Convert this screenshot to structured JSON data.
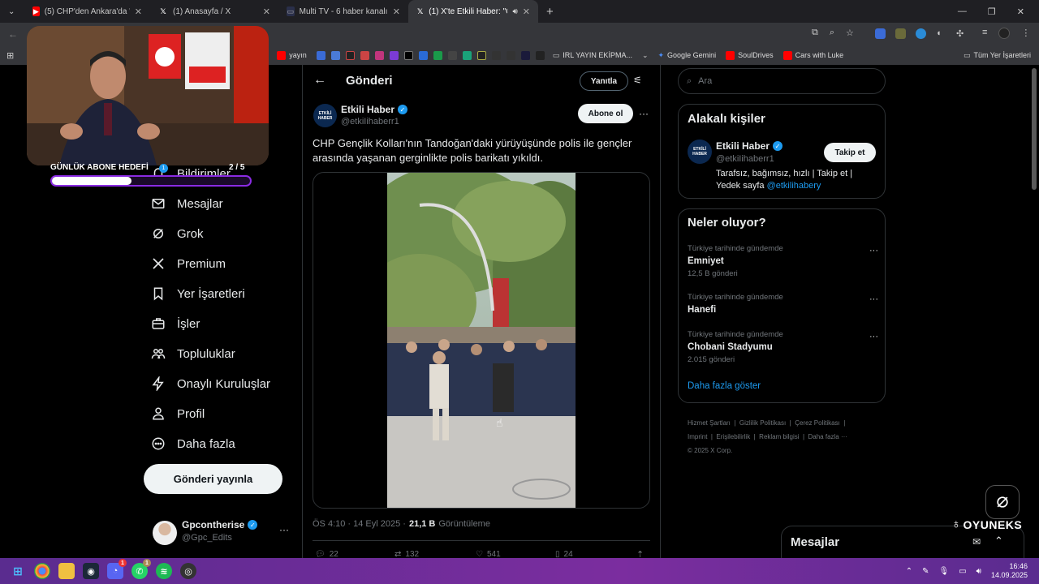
{
  "tabs": [
    {
      "label": "(5) CHP'den Ankara'da \"Vesayet",
      "icon": "youtube-icon",
      "color": "#ff0000"
    },
    {
      "label": "(1) Anasayfa / X",
      "icon": "x-icon",
      "color": "#ffffff"
    },
    {
      "label": "Multi TV - 6 haber kanalını ayn",
      "icon": "tv-icon",
      "color": "#333333"
    },
    {
      "label": "(1) X'te Etkili Haber: \"CHP G",
      "icon": "x-icon",
      "color": "#ffffff"
    }
  ],
  "bookmarks": [
    {
      "label": "yayın",
      "color": "#ff0000"
    },
    {
      "label": "IRL YAYIN EKİPMA...",
      "color": "#888888"
    },
    {
      "label": "Google Gemini",
      "color": "#4a8cf7"
    },
    {
      "label": "SoulDrives",
      "color": "#ff0000"
    },
    {
      "label": "Cars with Luke",
      "color": "#ff0000"
    },
    {
      "label": "Tüm Yer İşaretleri",
      "color": "#cccccc"
    }
  ],
  "overlay": {
    "goal_label": "GÜNLÜK ABONE HEDEFİ",
    "goal_count": "2 / 5",
    "goal_progress": 0.4,
    "badge": "1"
  },
  "nav": [
    {
      "label": "Bildirimler",
      "icon": "bell-icon"
    },
    {
      "label": "Mesajlar",
      "icon": "mail-icon"
    },
    {
      "label": "Grok",
      "icon": "grok-icon"
    },
    {
      "label": "Premium",
      "icon": "x-logo-icon"
    },
    {
      "label": "Yer İşaretleri",
      "icon": "bookmark-icon"
    },
    {
      "label": "İşler",
      "icon": "briefcase-icon"
    },
    {
      "label": "Topluluklar",
      "icon": "people-icon"
    },
    {
      "label": "Onaylı Kuruluşlar",
      "icon": "lightning-icon"
    },
    {
      "label": "Profil",
      "icon": "person-icon"
    },
    {
      "label": "Daha fazla",
      "icon": "more-circle-icon"
    }
  ],
  "post_button": "Gönderi yayınla",
  "account": {
    "name": "Gpcontherise",
    "handle": "@Gpc_Edits"
  },
  "header": {
    "title": "Gönderi",
    "reply": "Yanıtla"
  },
  "tweet": {
    "author": "Etkili Haber",
    "handle": "@etkiIihaberr1",
    "avatar_text": "ETKİLİ HABER",
    "subscribe": "Abone ol",
    "text": "CHP Gençlik Kolları'nın Tandoğan'daki yürüyüşünde polis ile gençler arasında yaşanan gerginlikte polis barikatı yıkıldı.",
    "time": "ÖS 4:10 · 14 Eyl 2025 ·",
    "views": "21,1 B",
    "views_label": "Görüntüleme",
    "replies": "22",
    "retweets": "132",
    "likes": "541",
    "bookmarks": "24"
  },
  "search_placeholder": "Ara",
  "related": {
    "title": "Alakalı kişiler",
    "name": "Etkili Haber",
    "handle": "@etkiIihaberr1",
    "follow": "Takip et",
    "bio": "Tarafsız, bağımsız, hızlı | Takip et | Yedek sayfa",
    "bio_link": "@etkilihabery"
  },
  "trends": {
    "title": "Neler oluyor?",
    "items": [
      {
        "context": "Türkiye tarihinde gündemde",
        "name": "Emniyet",
        "count": "12,5 B gönderi"
      },
      {
        "context": "Türkiye tarihinde gündemde",
        "name": "Hanefi",
        "count": ""
      },
      {
        "context": "Türkiye tarihinde gündemde",
        "name": "Chobani Stadyumu",
        "count": "2.015 gönderi"
      }
    ],
    "more": "Daha fazla göster"
  },
  "footer": {
    "links": [
      "Hizmet Şartları",
      "Gizlilik Politikası",
      "Çerez Politikası",
      "Imprint",
      "Erişilebilirlik",
      "Reklam bilgisi",
      "Daha fazla ···"
    ],
    "copyright": "© 2025 X Corp."
  },
  "messages_title": "Mesajlar",
  "watermark": "OYUNEKS",
  "clock": {
    "time": "16:46",
    "date": "14.09.2025"
  },
  "taskbar_badges": [
    "1",
    "1"
  ]
}
